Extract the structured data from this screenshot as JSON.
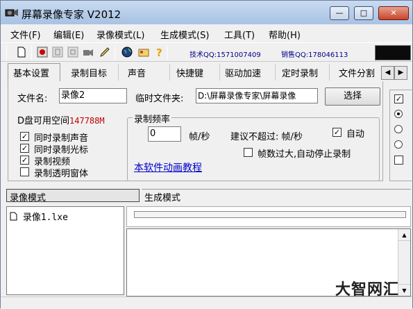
{
  "window": {
    "title": "屏幕录像专家 V2012"
  },
  "menu": [
    "文件(F)",
    "编辑(E)",
    "录像模式(L)",
    "生成模式(S)",
    "工具(T)",
    "帮助(H)"
  ],
  "toolbar": {
    "tech_qq": "技术QQ:1571007409",
    "sales_qq": "销售QQ:178046113"
  },
  "tabs": [
    "基本设置",
    "录制目标",
    "声音",
    "快捷键",
    "驱动加速",
    "定时录制",
    "文件分割"
  ],
  "basic": {
    "filename_label": "文件名:",
    "filename_value": "录像2",
    "temp_label": "临时文件夹:",
    "temp_value": "D:\\屏幕录像专家\\屏幕录像",
    "choose_button": "选择",
    "disk_label": "D盘可用空间",
    "disk_value": "147788M",
    "checkboxes": [
      {
        "label": "同时录制声音",
        "checked": true
      },
      {
        "label": "同时录制光标",
        "checked": true
      },
      {
        "label": "录制视频",
        "checked": true
      },
      {
        "label": "录制透明窗体",
        "checked": false
      }
    ],
    "framerate_group": "录制频率",
    "fps_value": "0",
    "fps_unit": "帧/秒",
    "suggest_label": "建议不超过: 帧/秒",
    "auto_label": "自动",
    "auto_checked": true,
    "stop_label": "帧数过大,自动停止录制",
    "stop_checked": false,
    "tutorial_link": "本软件动画教程"
  },
  "modes": {
    "record": "录像模式",
    "generate": "生成模式"
  },
  "files": [
    {
      "name": "录像1.lxe"
    }
  ],
  "watermark": "大智网汇"
}
